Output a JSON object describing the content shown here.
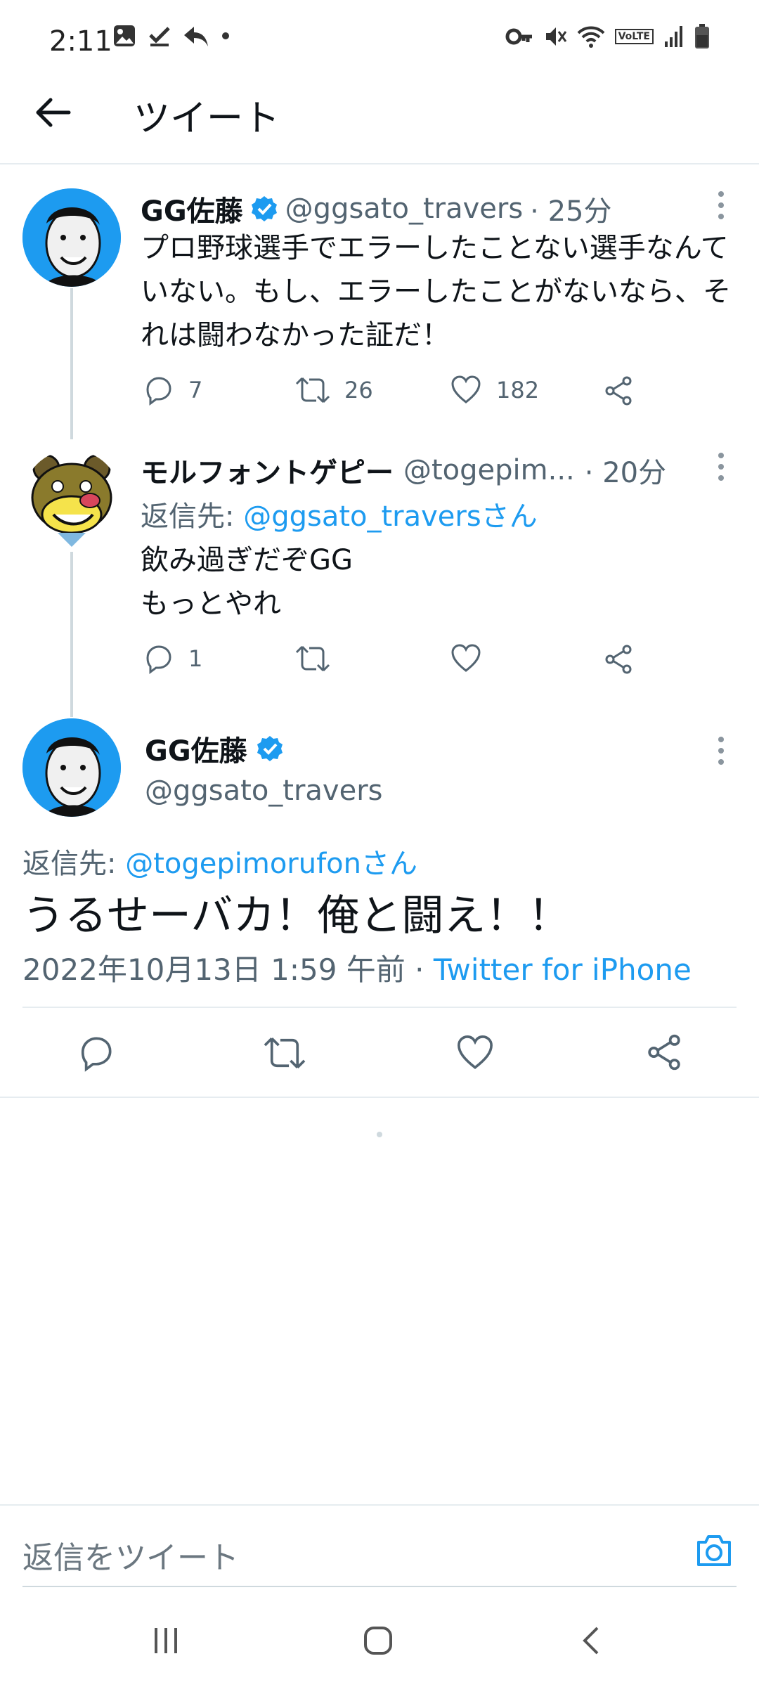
{
  "status_bar": {
    "time": "2:11",
    "left_icons": [
      "image-icon",
      "checkmark-icon",
      "reply-icon",
      "dot-icon"
    ],
    "right_icons": [
      "key-icon",
      "mute-icon",
      "wifi-icon",
      "volte-icon",
      "signal-icon",
      "battery-icon"
    ],
    "volte_label": "VoLTE"
  },
  "header": {
    "title": "ツイート"
  },
  "tweets": [
    {
      "name": "GG佐藤",
      "verified": true,
      "handle": "@ggsato_travers",
      "time": "· 25分",
      "text": "プロ野球選手でエラーしたことない選手なんていない。もし、エラーしたことがないなら、それは闘わなかった証だ！",
      "replies": "7",
      "retweets": "26",
      "likes": "182"
    },
    {
      "name": "モルフォントゲピー",
      "handle": "@togepim...",
      "time": "· 20分",
      "replying_prefix": "返信先: ",
      "replying_to": "@ggsato_traversさん",
      "text": "飲み過ぎだぞGG\nもっとやれ",
      "replies": "1",
      "retweets": "",
      "likes": ""
    }
  ],
  "focused": {
    "name": "GG佐藤",
    "verified": true,
    "handle": "@ggsato_travers",
    "replying_prefix": "返信先: ",
    "replying_to": "@togepimorufonさん",
    "text": "うるせーバカ！俺と闘え！！",
    "datetime": "2022年10月13日 1:59 午前 · ",
    "source": "Twitter for iPhone"
  },
  "composer": {
    "placeholder": "返信をツイート"
  },
  "colors": {
    "accent": "#1d9bf0",
    "muted": "#536471",
    "divider": "#e6ecf0"
  }
}
